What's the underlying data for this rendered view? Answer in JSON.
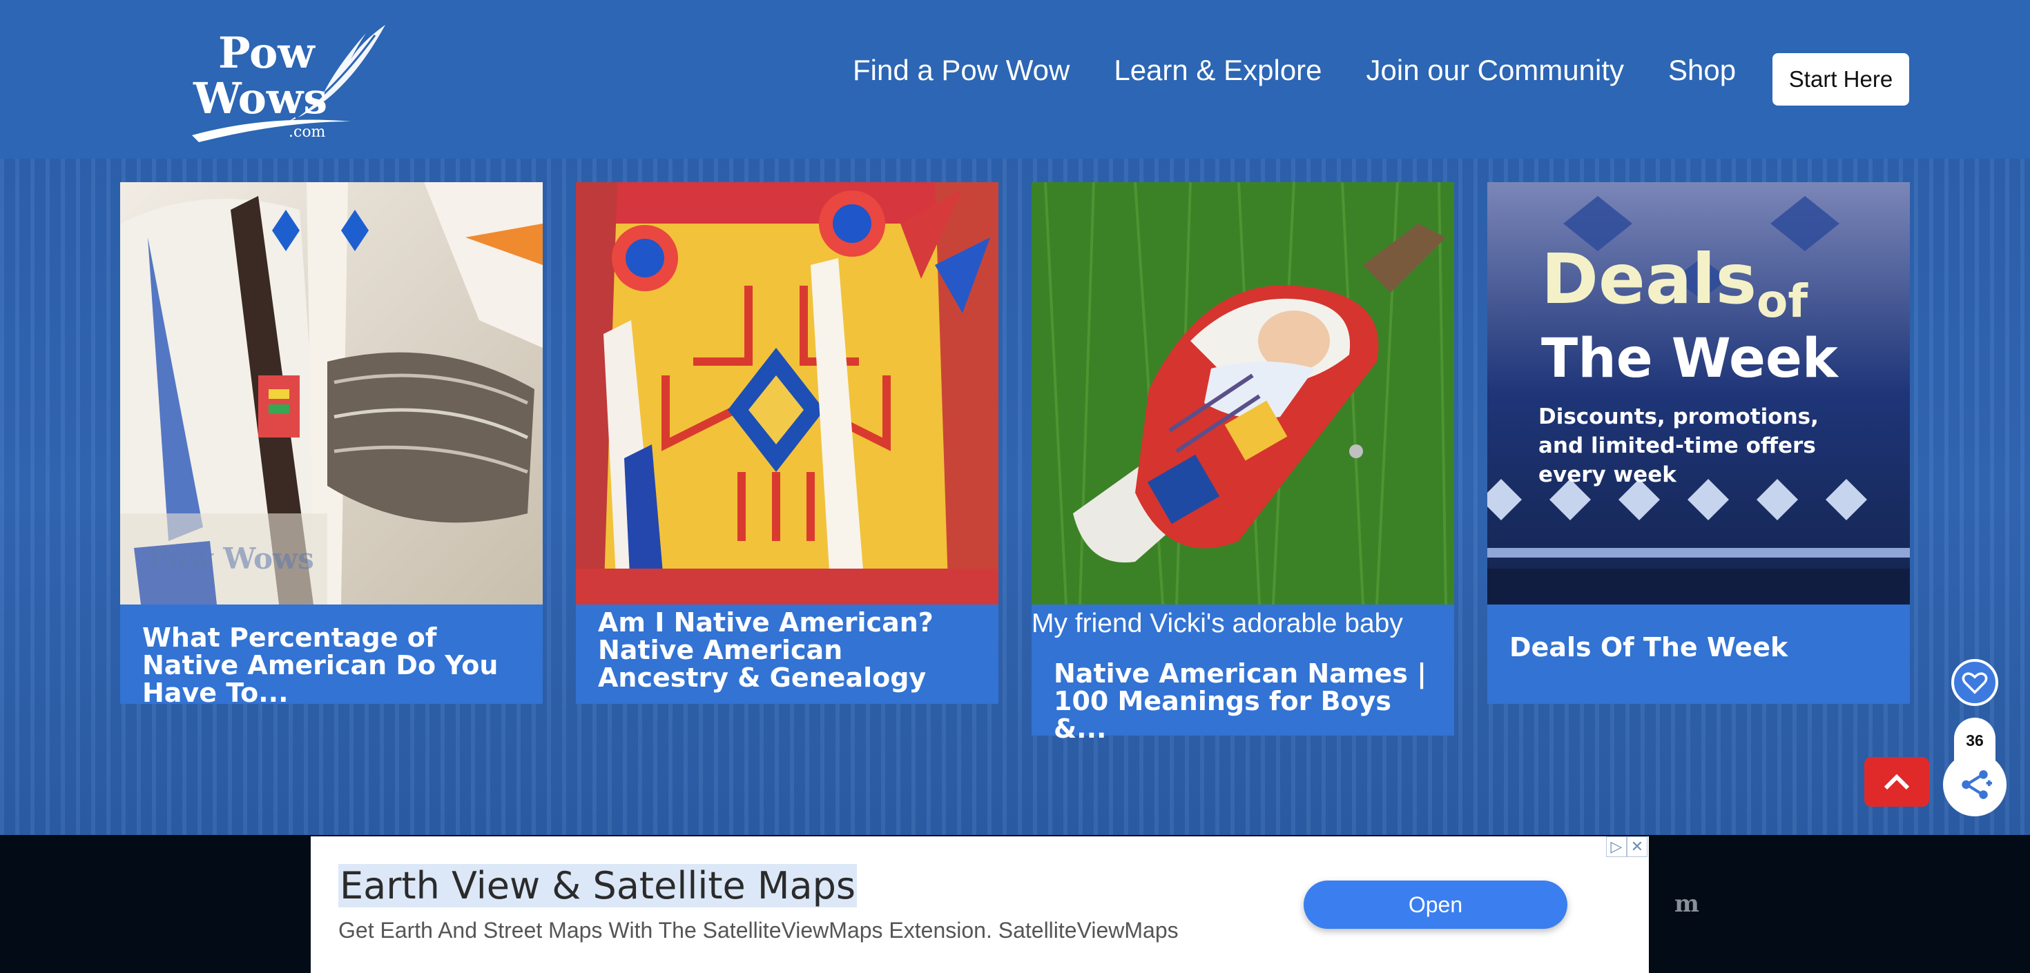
{
  "header": {
    "logo_line1": "Pow",
    "logo_line2": "Wows",
    "logo_domain": ".com",
    "nav": [
      "Find a Pow Wow",
      "Learn & Explore",
      "Join our Community",
      "Shop"
    ],
    "cta": "Start Here"
  },
  "cards": [
    {
      "title": "What Percentage of Native American Do You Have To...",
      "image": "regalia-feather-fan-photo",
      "watermark": "Pow Wows"
    },
    {
      "title": "Am I Native American? Native American Ancestry & Genealogy",
      "image": "yellow-beaded-regalia-photo"
    },
    {
      "caption": "My friend Vicki's adorable baby",
      "title": "Native American Names | 100 Meanings for Boys &...",
      "image": "baby-cradleboard-photo"
    },
    {
      "title": "Deals Of The Week",
      "image": "deals-banner",
      "banner": {
        "line1a": "Deals",
        "line1b": "of",
        "line2": "The Week",
        "body": [
          "Discounts, promotions,",
          "and limited-time offers",
          "every week"
        ]
      }
    }
  ],
  "floating": {
    "share_count": "36",
    "fav_icon": "heart-icon",
    "share_icon": "share-icon",
    "top_icon": "chevron-up-icon"
  },
  "ad": {
    "title": "Earth View & Satellite Maps",
    "subtitle": "Get Earth And Street Maps With The SatelliteViewMaps Extension. SatelliteViewMaps",
    "button": "Open",
    "choices_icon": "▷",
    "close_icon": "✕",
    "mark": "m"
  },
  "colors": {
    "header_bg": "#2c66b4",
    "card_title_bg": "#3273d4",
    "accent_red": "#e02a2a",
    "ad_button": "#3b7ef0"
  }
}
